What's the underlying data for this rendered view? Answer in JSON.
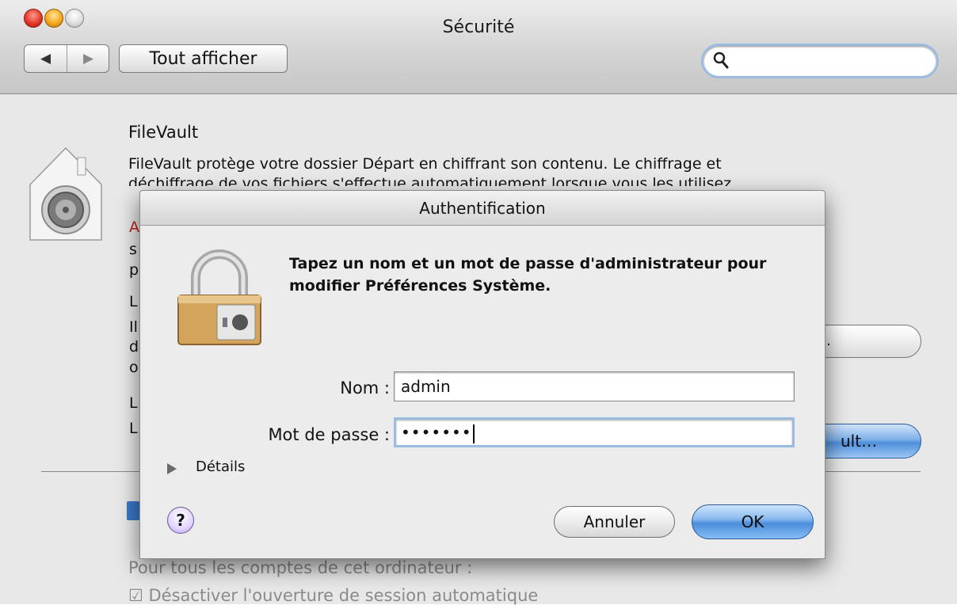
{
  "window": {
    "title": "Sécurité"
  },
  "toolbar": {
    "back_glyph": "◀",
    "forward_glyph": "▶",
    "show_all_label": "Tout afficher",
    "search_placeholder": ""
  },
  "filevault": {
    "title": "FileVault",
    "desc_line1": "FileVault protège votre dossier Départ en chiffrant son contenu. Le chiffrage et",
    "desc_line2": "déchiffrage de vos fichiers s'effectue automatiquement lorsque vous les utilisez",
    "partial_letters": [
      "A",
      "s",
      "p",
      "L",
      "Il",
      "d",
      "o",
      "L",
      "L"
    ],
    "button1_label": "…",
    "button2_label": "ult…",
    "accounts_label": "Pour tous les comptes de cet ordinateur :",
    "option_label": "Désactiver l'ouverture de session automatique"
  },
  "dialog": {
    "title": "Authentification",
    "message": "Tapez un nom et un mot de passe d'administrateur pour modifier Préférences Système.",
    "name_label": "Nom :",
    "name_value": "admin",
    "password_label": "Mot de passe :",
    "password_value": "•••••••",
    "details_label": "Détails",
    "help_label": "?",
    "cancel_label": "Annuler",
    "ok_label": "OK"
  },
  "colors": {
    "accent_blue": "#4f8fdb",
    "warning_red": "#c0211a",
    "focus_ring": "#9cbbe0"
  },
  "icons": [
    "close-icon",
    "minimize-icon",
    "zoom-icon",
    "back-arrow-icon",
    "forward-arrow-icon",
    "search-icon",
    "filevault-icon",
    "lock-icon",
    "disclosure-triangle-icon",
    "help-icon"
  ]
}
